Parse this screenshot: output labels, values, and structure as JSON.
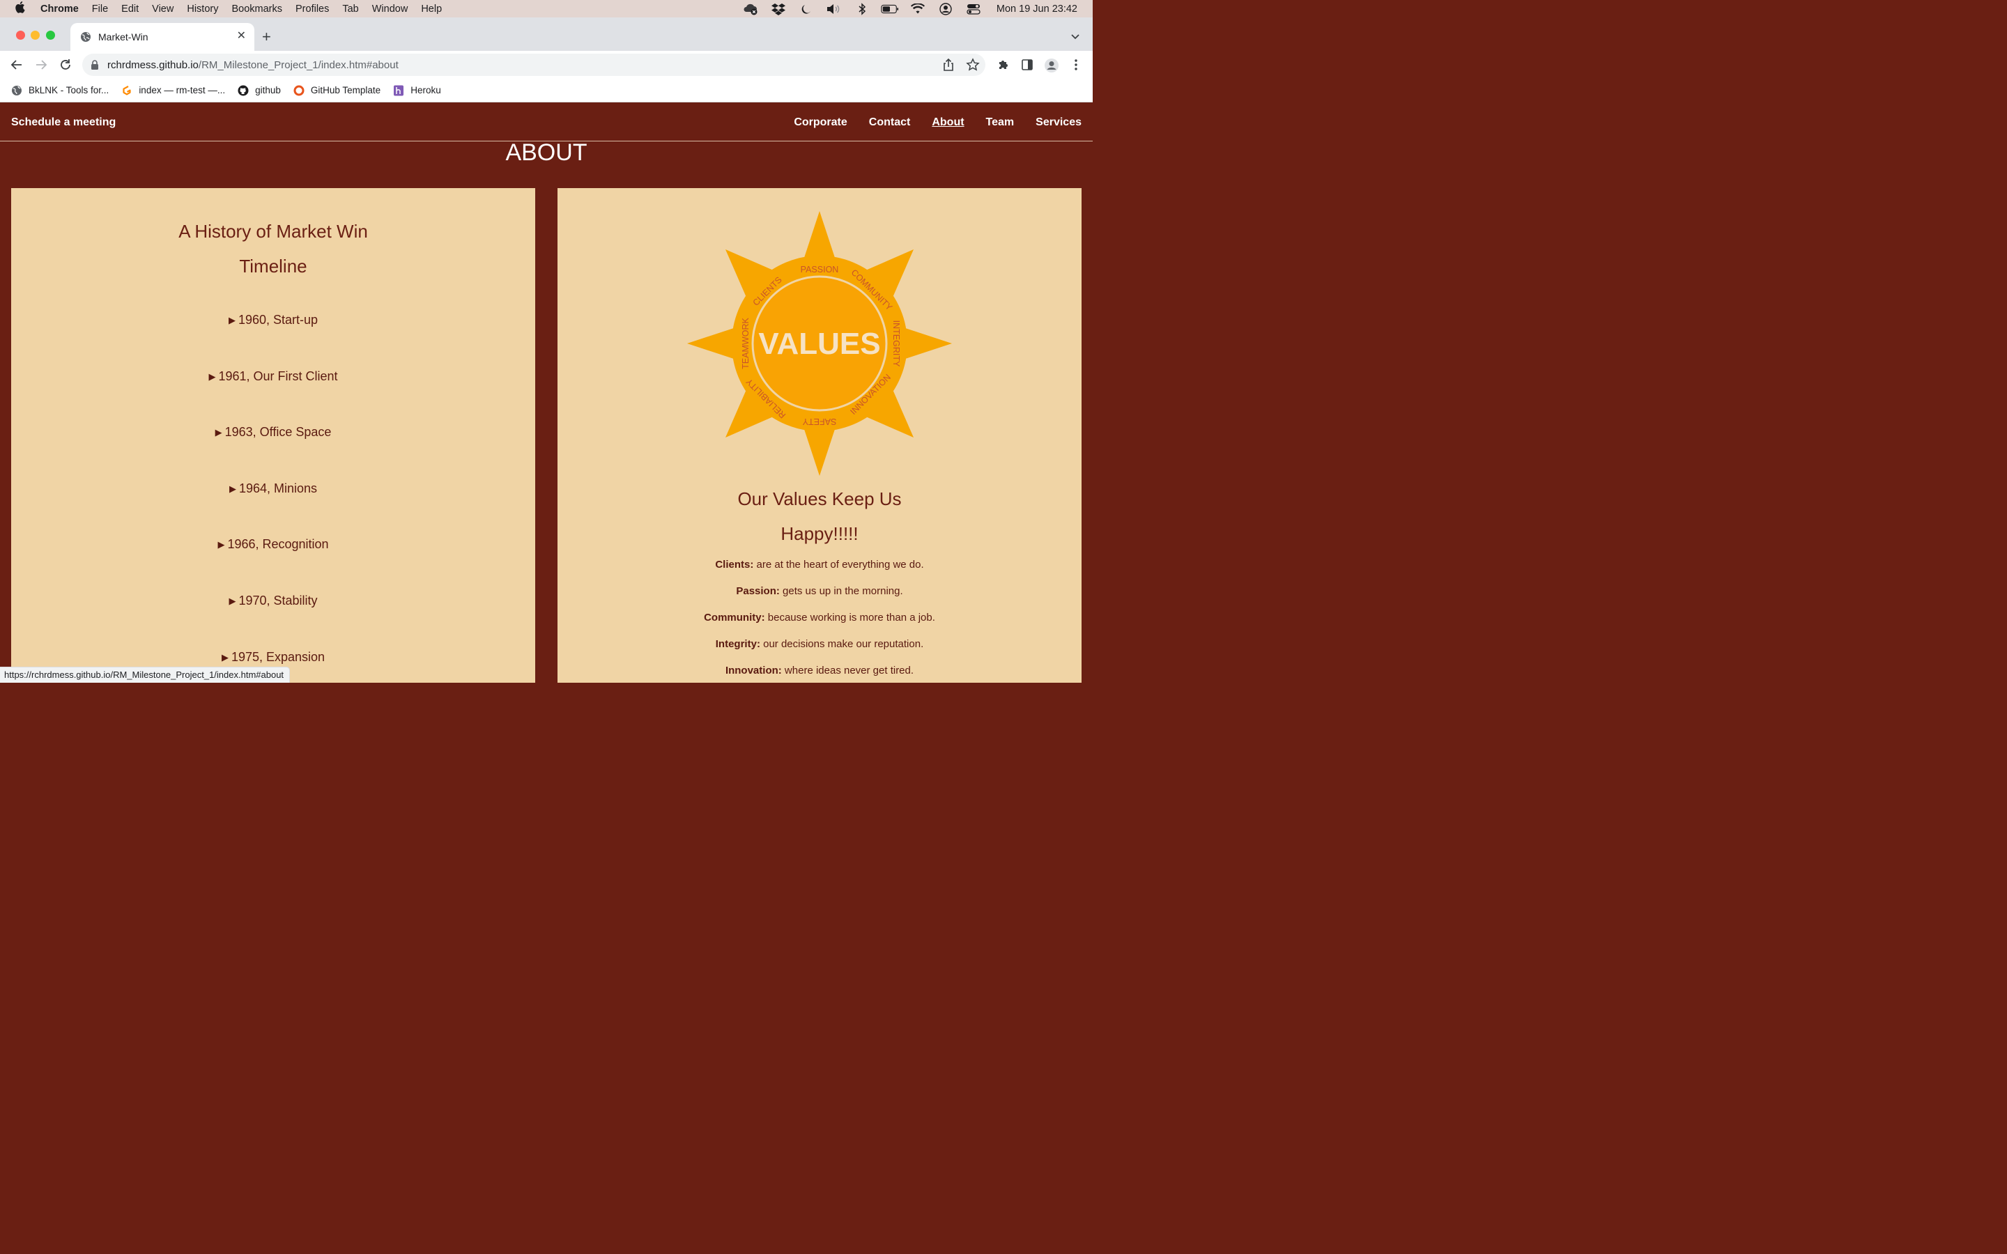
{
  "menubar": {
    "app": "Chrome",
    "items": [
      "File",
      "Edit",
      "View",
      "History",
      "Bookmarks",
      "Profiles",
      "Tab",
      "Window",
      "Help"
    ],
    "clock": "Mon 19 Jun  23:42"
  },
  "tab": {
    "title": "Market-Win"
  },
  "omnibox": {
    "host": "rchrdmess.github.io",
    "path": "/RM_Milestone_Project_1/index.htm#about"
  },
  "bookmarks": [
    {
      "label": "BkLNK - Tools for...",
      "icon": "globe-icon"
    },
    {
      "label": "index — rm-test —...",
      "icon": "gitpod-icon"
    },
    {
      "label": "github",
      "icon": "github-icon"
    },
    {
      "label": "GitHub Template",
      "icon": "template-icon"
    },
    {
      "label": "Heroku",
      "icon": "heroku-icon"
    }
  ],
  "site": {
    "brand": "Schedule a meeting",
    "nav": [
      "Corporate",
      "Contact",
      "About",
      "Team",
      "Services"
    ],
    "active_nav": "About",
    "heading": "ABOUT"
  },
  "history": {
    "title_line1": "A History of Market Win",
    "title_line2": "Timeline",
    "items": [
      "1960, Start-up",
      "1961, Our First Client",
      "1963, Office Space",
      "1964, Minions",
      "1966, Recognition",
      "1970, Stability",
      "1975, Expansion"
    ]
  },
  "values": {
    "image_center": "VALUES",
    "image_words": [
      "PASSION",
      "COMMUNITY",
      "INTEGRITY",
      "INNOVATION",
      "SAFETY",
      "RELIABILITY",
      "TEAMWORK",
      "CLIENTS"
    ],
    "title_line1": "Our Values Keep Us",
    "title_line2": "Happy!!!!!",
    "items": [
      {
        "term": "Clients:",
        "text": " are at the heart of everything we do."
      },
      {
        "term": "Passion:",
        "text": " gets us up in the morning."
      },
      {
        "term": "Community:",
        "text": " because working is more than a job."
      },
      {
        "term": "Integrity:",
        "text": " our decisions make our reputation."
      },
      {
        "term": "Innovation:",
        "text": " where ideas never get tired."
      }
    ]
  },
  "statusbar": {
    "url": "https://rchrdmess.github.io/RM_Milestone_Project_1/index.htm#about"
  },
  "colors": {
    "page_bg": "#6a1f13",
    "card_bg": "#f0d4a5",
    "sun": "#f7a600",
    "text": "#6a1f13"
  }
}
